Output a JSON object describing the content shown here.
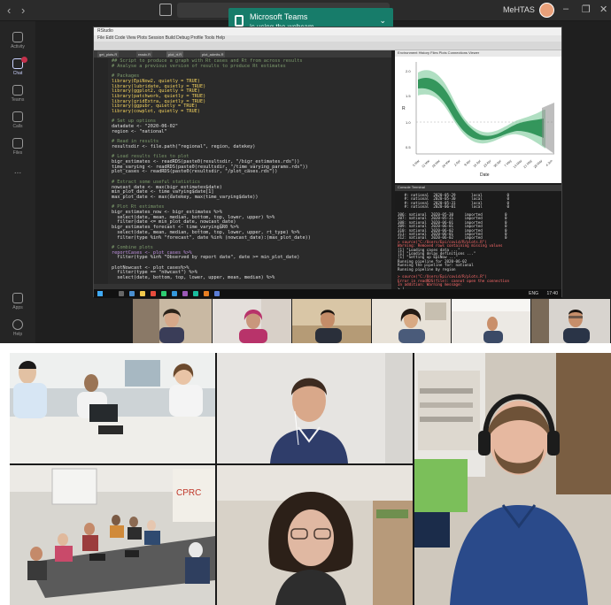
{
  "teams": {
    "org_name": "MeHTAS",
    "rail": [
      {
        "label": "Activity"
      },
      {
        "label": "Chat"
      },
      {
        "label": "Teams"
      },
      {
        "label": "Calls"
      },
      {
        "label": "Files"
      },
      {
        "label": "..."
      },
      {
        "label": "Apps"
      },
      {
        "label": "Help"
      }
    ],
    "notification": {
      "title": "Microsoft Teams",
      "subtitle": "is using the webcam"
    }
  },
  "rstudio": {
    "title": "RStudio",
    "menu": "File  Edit  Code  View  Plots  Session  Build  Debug  Profile  Tools  Help",
    "tabs": [
      "get_plots.R",
      "readx.R",
      "plot_rt.R",
      "plot_admits.R"
    ],
    "code_lines": [
      {
        "text": "## Script to produce a graph with Rt cases and Rt from across results",
        "style": "comment"
      },
      {
        "text": "# Analyse a previous version of results to produce Rt estimates",
        "style": "comment"
      },
      {
        "text": "",
        "style": "plain"
      },
      {
        "text": "# Packages",
        "style": "comment"
      },
      {
        "text": "library(EpiNow2, quietly = TRUE)",
        "style": "code"
      },
      {
        "text": "library(lubridate, quietly = TRUE)",
        "style": "code"
      },
      {
        "text": "library(ggplot2, quietly = TRUE)",
        "style": "code"
      },
      {
        "text": "library(patchwork, quietly = TRUE)",
        "style": "code"
      },
      {
        "text": "library(gridExtra, quietly = TRUE)",
        "style": "code"
      },
      {
        "text": "library(ggpubr, quietly = TRUE)",
        "style": "code"
      },
      {
        "text": "library(cowplot, quietly = TRUE)",
        "style": "code"
      },
      {
        "text": "",
        "style": "plain"
      },
      {
        "text": "# Set up options",
        "style": "comment"
      },
      {
        "text": "datadate <- \"2020-06-02\"",
        "style": "plain"
      },
      {
        "text": "region <- \"national\"",
        "style": "plain"
      },
      {
        "text": "",
        "style": "plain"
      },
      {
        "text": "# Read in results",
        "style": "comment"
      },
      {
        "text": "resultsdir <- file.path(\"regional\", region, datekey)",
        "style": "plain"
      },
      {
        "text": "",
        "style": "plain"
      },
      {
        "text": "# Load results files to plot",
        "style": "comment"
      },
      {
        "text": "bigr_estimates <- readRDS(paste0(resultsdir, \"/bigr_estimates.rds\"))",
        "style": "plain"
      },
      {
        "text": "time_varying <- readRDS(paste0(resultsdir, \"/time_varying_params.rds\"))",
        "style": "plain"
      },
      {
        "text": "plot_cases <- readRDS(paste0(resultsdir, \"/plot_cases.rds\"))",
        "style": "plain"
      },
      {
        "text": "",
        "style": "plain"
      },
      {
        "text": "# Extract some useful statistics",
        "style": "comment"
      },
      {
        "text": "nowcast_date <- max(bigr_estimates$date)",
        "style": "plain"
      },
      {
        "text": "min_plot_date <- time_varying$date[1]",
        "style": "plain"
      },
      {
        "text": "max_plot_date <- max(datekey, max(time_varying$date))",
        "style": "plain"
      },
      {
        "text": "",
        "style": "plain"
      },
      {
        "text": "# Plot Rt estimates",
        "style": "comment"
      },
      {
        "text": "bigr_estimates_now <- bigr_estimates %>%",
        "style": "plain"
      },
      {
        "text": "  select(date, mean, median, bottom, top, lower, upper) %>%",
        "style": "plain"
      },
      {
        "text": "  filter(date <= min_plot_date, nowcast_date)",
        "style": "plain"
      },
      {
        "text": "bigr_estimates_forecast <- time_varying$R0 %>%",
        "style": "plain"
      },
      {
        "text": "  select(date, mean, median, bottom, top, lower, upper, rt_type) %>%",
        "style": "plain"
      },
      {
        "text": "  filter(type %in% \"forecast\", date %in% (nowcast_date):(max_plot_date))",
        "style": "plain"
      },
      {
        "text": "",
        "style": "plain"
      },
      {
        "text": "# Combine plots",
        "style": "comment"
      },
      {
        "text": "reportCases <- plot_cases %>%",
        "style": "purple"
      },
      {
        "text": "  filter(type %in% \"Observed by report date\", date >= min_plot_date)",
        "style": "plain"
      },
      {
        "text": "",
        "style": "plain"
      },
      {
        "text": "plotNowcast <- plot_cases%>%",
        "style": "plain"
      },
      {
        "text": "  filter(type == \"nowcast\") %>%",
        "style": "plain"
      },
      {
        "text": "  select(date, bottom, top, lower, upper, mean, median) %>%",
        "style": "plain"
      }
    ],
    "plot_tabs": "Environment  History  Files  Plots  Connections  Viewer",
    "plot_xlabel": "Date",
    "plot_ylabel": "R",
    "chart_y_ticks": [
      "2.0",
      "1.5",
      "1.0",
      "0.5"
    ],
    "chart_x_ticks": [
      "5 Mar",
      "12 Mar",
      "19 Mar",
      "26 Mar",
      "2 Apr",
      "9 Apr",
      "16 Apr",
      "23 Apr",
      "30 Apr",
      "7 May",
      "14 May",
      "21 May",
      "28 May",
      "4 Jun"
    ],
    "console_tabs": "Console  Terminal",
    "console_lines": [
      {
        "text": "   #: national  2020-05-29       local           0",
        "style": "white"
      },
      {
        "text": "   #: national  2020-05-30       local           0",
        "style": "white"
      },
      {
        "text": "   #: national  2020-05-31       local           0",
        "style": "white"
      },
      {
        "text": "   #: national  2020-06-01       local           0",
        "style": "white"
      },
      {
        "text": "",
        "style": "white"
      },
      {
        "text": "306: national  2020-05-30     imported          0",
        "style": "white"
      },
      {
        "text": "307: national  2020-05-31     imported          0",
        "style": "white"
      },
      {
        "text": "308: national  2020-06-01     imported          0",
        "style": "white"
      },
      {
        "text": "309: national  2020-06-01     imported          0",
        "style": "white"
      },
      {
        "text": "310: national  2020-06-02     imported          0",
        "style": "white"
      },
      {
        "text": "311: national  2020-06-01     imported          0",
        "style": "white"
      },
      {
        "text": "312: national  2020-06-02     imported          0",
        "style": "white"
      },
      {
        "text": "> source(\"C:/Users/Epi/covid/R/plots.R\")",
        "style": "red"
      },
      {
        "text": "Warning: Removed rows containing missing values",
        "style": "red"
      },
      {
        "text": "[1] \"Loading cases data ...\"",
        "style": "white"
      },
      {
        "text": "[1] \"Loading delay definitions ...\"",
        "style": "white"
      },
      {
        "text": "[1] \"Setting up EpiNow ...\"",
        "style": "white"
      },
      {
        "text": "Running pipeline for 2020-06-02",
        "style": "white"
      },
      {
        "text": "Running the pipeline for: national",
        "style": "white"
      },
      {
        "text": "Running pipeline by region",
        "style": "white"
      },
      {
        "text": "",
        "style": "white"
      },
      {
        "text": "> source(\"C:/Users/Epi/covid/R/plots.R\")",
        "style": "red"
      },
      {
        "text": "Error in readRDS(file): cannot open the connection",
        "style": "red"
      },
      {
        "text": "In addition: Warning message:",
        "style": "red"
      },
      {
        "text": "> |",
        "style": "white"
      }
    ],
    "taskbar_time": "17:40",
    "taskbar_lang": "ENG"
  },
  "colors": {
    "teams_bg": "#1f1f1f",
    "notify_green": "#177c6a",
    "plot_ribbon_dark": "#1e8a4a",
    "plot_ribbon_light": "#8fd2a8"
  }
}
